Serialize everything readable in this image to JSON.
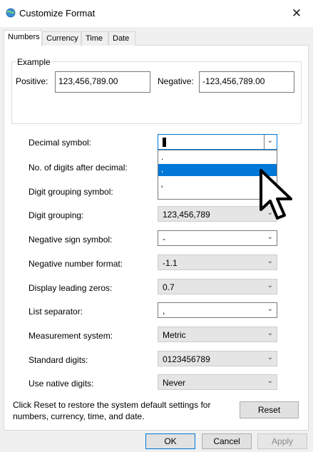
{
  "window": {
    "title": "Customize Format",
    "close_label": "✕"
  },
  "tabs": [
    "Numbers",
    "Currency",
    "Time",
    "Date"
  ],
  "example": {
    "title": "Example",
    "positive_label": "Positive:",
    "positive_value": "123,456,789.00",
    "negative_label": "Negative:",
    "negative_value": "-123,456,789.00"
  },
  "settings": [
    {
      "label": "Decimal symbol:",
      "value": ""
    },
    {
      "label": "No. of digits after decimal:",
      "value": ""
    },
    {
      "label": "Digit grouping symbol:",
      "value": ""
    },
    {
      "label": "Digit grouping:",
      "value": "123,456,789"
    },
    {
      "label": "Negative sign symbol:",
      "value": "-"
    },
    {
      "label": "Negative number format:",
      "value": "-1.1"
    },
    {
      "label": "Display leading zeros:",
      "value": "0.7"
    },
    {
      "label": "List separator:",
      "value": ","
    },
    {
      "label": "Measurement system:",
      "value": "Metric"
    },
    {
      "label": "Standard digits:",
      "value": "0123456789"
    },
    {
      "label": "Use native digits:",
      "value": "Never"
    }
  ],
  "decimal_dropdown": {
    "options": [
      ".",
      ",",
      "'"
    ],
    "selected_index": 1
  },
  "reset": {
    "text": "Click Reset to restore the system default settings for numbers, currency, time, and date.",
    "button": "Reset"
  },
  "footer": {
    "ok": "OK",
    "cancel": "Cancel",
    "apply": "Apply"
  },
  "colors": {
    "accent": "#0078d7",
    "panel": "#ffffff",
    "chrome": "#f0f0f0"
  },
  "icons": {
    "app": "globe-settings-icon",
    "dropdown": "chevron-down-icon",
    "cursor": "mouse-pointer-icon"
  }
}
